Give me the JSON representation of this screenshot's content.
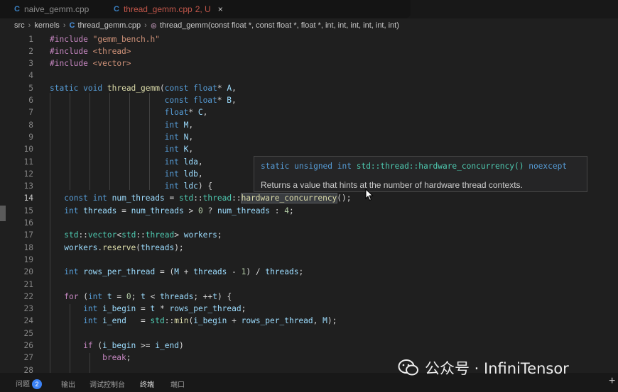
{
  "tabs": [
    {
      "icon": "C",
      "label": "naive_gemm.cpp"
    },
    {
      "icon": "C",
      "label": "thread_gemm.cpp",
      "status": "2, U",
      "close": "×"
    }
  ],
  "breadcrumb": {
    "root": "src",
    "folder": "kernels",
    "file": "thread_gemm.cpp",
    "symbol": "thread_gemm(const float *, const float *, float *, int, int, int, int, int, int)"
  },
  "gutter": [
    "1",
    "2",
    "3",
    "4",
    "5",
    "6",
    "7",
    "8",
    "9",
    "10",
    "11",
    "12",
    "13",
    "14",
    "15",
    "16",
    "17",
    "18",
    "19",
    "20",
    "21",
    "22",
    "23",
    "24",
    "25",
    "26",
    "27",
    "28"
  ],
  "hover": {
    "signature_keywords": "static unsigned int",
    "signature_name": " std::thread::hardware_concurrency()",
    "signature_suffix": " noexcept",
    "description": "Returns a value that hints at the number of hardware thread contexts."
  },
  "panel": {
    "tabs": [
      "问题",
      "输出",
      "调试控制台",
      "终端",
      "端口"
    ],
    "problems_count": "2",
    "add": "+"
  },
  "watermark": "公众号 · InfiniTensor",
  "colors": {
    "keyword": "#569cd6",
    "type": "#4ec9b0",
    "function": "#dcdcaa",
    "variable": "#9cdcfe",
    "string": "#ce9178",
    "preprocessor": "#c586c0",
    "badge": "#3b82f6"
  }
}
